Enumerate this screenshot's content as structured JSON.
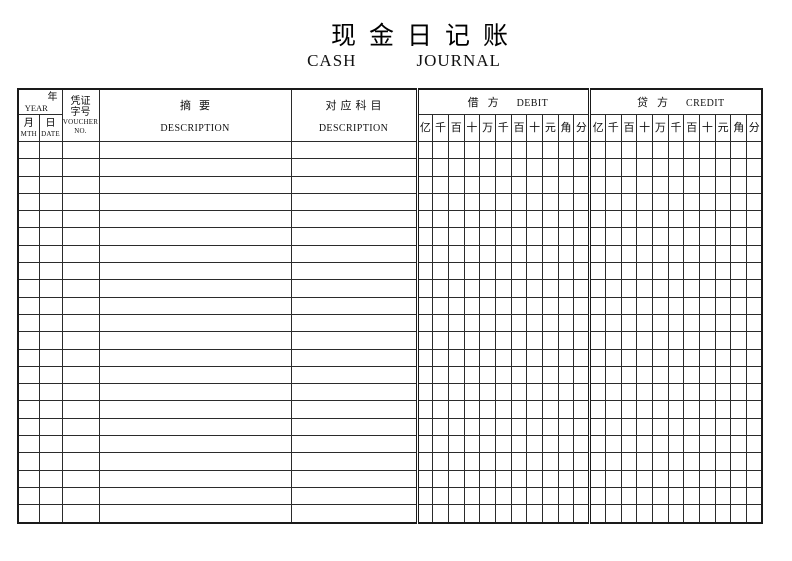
{
  "title": {
    "cn": "现金日记账",
    "en_cash": "CASH",
    "en_journal": "JOURNAL"
  },
  "table": {
    "header": {
      "year_cn": "年",
      "year_en": "YEAR",
      "mth_cn": "月",
      "mth_en": "MTH",
      "date_cn": "日",
      "date_en": "DATE",
      "voucher_cn_line1": "凭证",
      "voucher_cn_line2": "字号",
      "voucher_en_line1": "VOUCHER",
      "voucher_en_line2": "NO.",
      "digest_cn": "摘要",
      "digest_en": "DESCRIPTION",
      "subject_cn": "对应科目",
      "subject_en": "DESCRIPTION",
      "debit_cn": "借方",
      "debit_en": "DEBIT",
      "credit_cn": "贷方",
      "credit_en": "CREDIT"
    },
    "unit_columns": [
      "亿",
      "千",
      "百",
      "十",
      "万",
      "千",
      "百",
      "十",
      "元",
      "角",
      "分"
    ],
    "red_rule_before_unit": "角",
    "body_row_count": 22,
    "rows": []
  },
  "colors": {
    "rule_red": "#ff0000",
    "grid_black": "#2b2b2b",
    "frame_black": "#1a1a1a",
    "page_background": "#ffffff"
  }
}
